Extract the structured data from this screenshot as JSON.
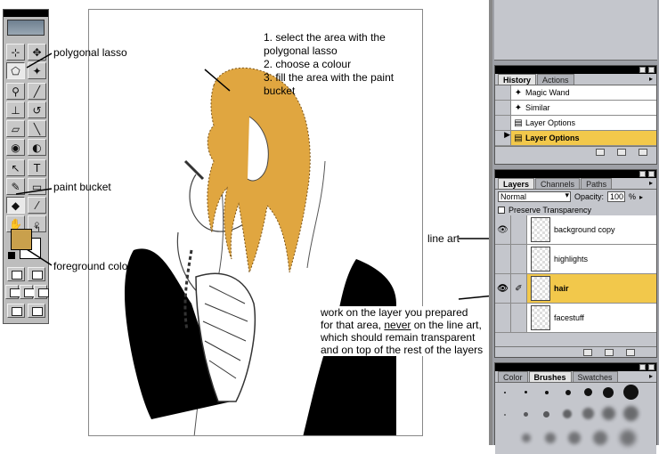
{
  "instructions": {
    "steps": [
      "1. select the area with the polygonal lasso",
      "2. choose a colour",
      "3. fill the area with the paint bucket"
    ]
  },
  "annotations": {
    "polygonal_lasso": "polygonal lasso",
    "paint_bucket": "paint bucket",
    "foreground_colour": "foreground colour",
    "line_art": "line art",
    "note_line1": "work on the layer you prepared",
    "note_line2_pre": "for that area, ",
    "note_line2_underlined": "never",
    "note_line2_post": " on the line art,",
    "note_line3": "which should remain transparent",
    "note_line4": "and on top of the rest of the layers"
  },
  "toolbox": {
    "icons": [
      "crop-icon",
      "move-icon",
      "polygonal-lasso-icon",
      "magic-wand-icon",
      "airbrush-icon",
      "paintbrush-icon",
      "rubber-stamp-icon",
      "history-brush-icon",
      "eraser-icon",
      "line-icon",
      "blur-icon",
      "dodge-icon",
      "path-selection-icon",
      "type-icon",
      "pen-icon",
      "rectangle-icon",
      "paint-bucket-icon",
      "eyedropper-icon",
      "hand-icon",
      "zoom-icon"
    ],
    "foreground_color": "#c9a04c",
    "background_color": "#ffffff"
  },
  "history": {
    "tabs": [
      "History",
      "Actions"
    ],
    "active_tab": "History",
    "items": [
      {
        "label": "Magic Wand"
      },
      {
        "label": "Similar"
      },
      {
        "label": "Layer Options"
      },
      {
        "label": "Layer Options",
        "selected": true
      }
    ]
  },
  "layers": {
    "tabs": [
      "Layers",
      "Channels",
      "Paths"
    ],
    "active_tab": "Layers",
    "blend_mode": "Normal",
    "opacity_label": "Opacity:",
    "opacity_value": "100",
    "opacity_unit": "%",
    "preserve_label": "Preserve Transparency",
    "items": [
      {
        "name": "background copy",
        "visible": true
      },
      {
        "name": "highlights",
        "visible": false
      },
      {
        "name": "hair",
        "visible": true,
        "selected": true
      },
      {
        "name": "facestuff",
        "visible": false
      }
    ]
  },
  "brushes": {
    "tabs": [
      "Color",
      "Brushes",
      "Swatches"
    ],
    "active_tab": "Brushes"
  },
  "colors": {
    "hair": "#e0a640",
    "selection_highlight": "#f2c84b",
    "panel_gray": "#c4c6cc"
  }
}
